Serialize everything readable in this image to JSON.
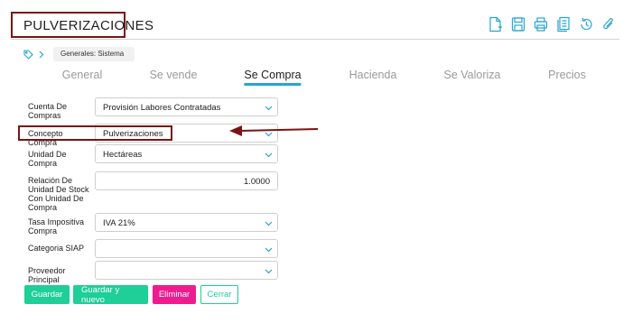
{
  "page": {
    "title": "PULVERIZACIONES"
  },
  "toolbar": {
    "icons": [
      "new-document-icon",
      "save-icon",
      "print-icon",
      "copy-icon",
      "history-icon",
      "attach-icon"
    ],
    "color": "#27a5cf"
  },
  "breadcrumb": {
    "items": [
      "Generales: Sistema"
    ]
  },
  "tabs": [
    {
      "label": "General"
    },
    {
      "label": "Se vende"
    },
    {
      "label": "Se Compra",
      "active": true
    },
    {
      "label": "Hacienda"
    },
    {
      "label": "Se Valoriza"
    },
    {
      "label": "Precios"
    }
  ],
  "form": {
    "cuenta_de_compras": {
      "label": "Cuenta De Compras",
      "value": "Provisión Labores Contratadas"
    },
    "concepto_compra": {
      "label": "Concepto Compra",
      "value": "Pulverizaciones"
    },
    "unidad_de_compra": {
      "label": "Unidad De Compra",
      "value": "Hectáreas"
    },
    "relacion_unidad": {
      "label": "Relación De Unidad De Stock Con Unidad De Compra",
      "value": "1.0000"
    },
    "tasa_impositiva": {
      "label": "Tasa Impositiva Compra",
      "value": "IVA 21%"
    },
    "categoria_siap": {
      "label": "Categoria SIAP",
      "value": ""
    },
    "proveedor_principal": {
      "label": "Proveedor Principal",
      "value": ""
    }
  },
  "buttons": {
    "guardar": "Guardar",
    "guardar_y_nuevo": "Guardar y nuevo",
    "eliminar": "Eliminar",
    "cerrar": "Cerrar"
  },
  "colors": {
    "accent": "#27a5cf",
    "primary_button": "#1ecf97",
    "danger_button": "#f01b8e",
    "annotation": "#7a1414"
  }
}
